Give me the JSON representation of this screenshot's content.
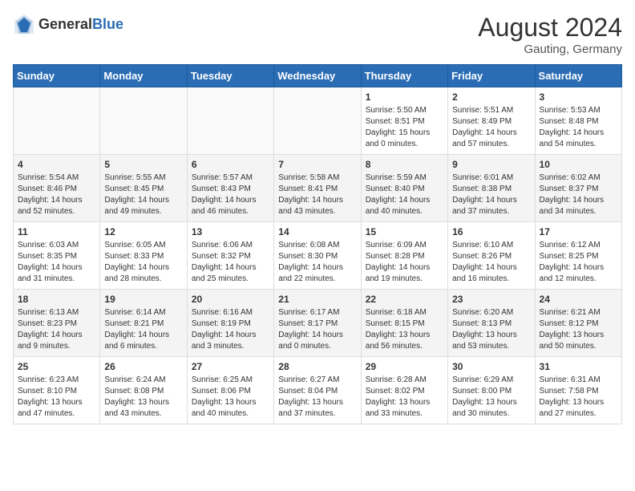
{
  "header": {
    "logo_general": "General",
    "logo_blue": "Blue",
    "month_year": "August 2024",
    "location": "Gauting, Germany"
  },
  "weekdays": [
    "Sunday",
    "Monday",
    "Tuesday",
    "Wednesday",
    "Thursday",
    "Friday",
    "Saturday"
  ],
  "weeks": [
    [
      {
        "day": "",
        "info": ""
      },
      {
        "day": "",
        "info": ""
      },
      {
        "day": "",
        "info": ""
      },
      {
        "day": "",
        "info": ""
      },
      {
        "day": "1",
        "info": "Sunrise: 5:50 AM\nSunset: 8:51 PM\nDaylight: 15 hours\nand 0 minutes."
      },
      {
        "day": "2",
        "info": "Sunrise: 5:51 AM\nSunset: 8:49 PM\nDaylight: 14 hours\nand 57 minutes."
      },
      {
        "day": "3",
        "info": "Sunrise: 5:53 AM\nSunset: 8:48 PM\nDaylight: 14 hours\nand 54 minutes."
      }
    ],
    [
      {
        "day": "4",
        "info": "Sunrise: 5:54 AM\nSunset: 8:46 PM\nDaylight: 14 hours\nand 52 minutes."
      },
      {
        "day": "5",
        "info": "Sunrise: 5:55 AM\nSunset: 8:45 PM\nDaylight: 14 hours\nand 49 minutes."
      },
      {
        "day": "6",
        "info": "Sunrise: 5:57 AM\nSunset: 8:43 PM\nDaylight: 14 hours\nand 46 minutes."
      },
      {
        "day": "7",
        "info": "Sunrise: 5:58 AM\nSunset: 8:41 PM\nDaylight: 14 hours\nand 43 minutes."
      },
      {
        "day": "8",
        "info": "Sunrise: 5:59 AM\nSunset: 8:40 PM\nDaylight: 14 hours\nand 40 minutes."
      },
      {
        "day": "9",
        "info": "Sunrise: 6:01 AM\nSunset: 8:38 PM\nDaylight: 14 hours\nand 37 minutes."
      },
      {
        "day": "10",
        "info": "Sunrise: 6:02 AM\nSunset: 8:37 PM\nDaylight: 14 hours\nand 34 minutes."
      }
    ],
    [
      {
        "day": "11",
        "info": "Sunrise: 6:03 AM\nSunset: 8:35 PM\nDaylight: 14 hours\nand 31 minutes."
      },
      {
        "day": "12",
        "info": "Sunrise: 6:05 AM\nSunset: 8:33 PM\nDaylight: 14 hours\nand 28 minutes."
      },
      {
        "day": "13",
        "info": "Sunrise: 6:06 AM\nSunset: 8:32 PM\nDaylight: 14 hours\nand 25 minutes."
      },
      {
        "day": "14",
        "info": "Sunrise: 6:08 AM\nSunset: 8:30 PM\nDaylight: 14 hours\nand 22 minutes."
      },
      {
        "day": "15",
        "info": "Sunrise: 6:09 AM\nSunset: 8:28 PM\nDaylight: 14 hours\nand 19 minutes."
      },
      {
        "day": "16",
        "info": "Sunrise: 6:10 AM\nSunset: 8:26 PM\nDaylight: 14 hours\nand 16 minutes."
      },
      {
        "day": "17",
        "info": "Sunrise: 6:12 AM\nSunset: 8:25 PM\nDaylight: 14 hours\nand 12 minutes."
      }
    ],
    [
      {
        "day": "18",
        "info": "Sunrise: 6:13 AM\nSunset: 8:23 PM\nDaylight: 14 hours\nand 9 minutes."
      },
      {
        "day": "19",
        "info": "Sunrise: 6:14 AM\nSunset: 8:21 PM\nDaylight: 14 hours\nand 6 minutes."
      },
      {
        "day": "20",
        "info": "Sunrise: 6:16 AM\nSunset: 8:19 PM\nDaylight: 14 hours\nand 3 minutes."
      },
      {
        "day": "21",
        "info": "Sunrise: 6:17 AM\nSunset: 8:17 PM\nDaylight: 14 hours\nand 0 minutes."
      },
      {
        "day": "22",
        "info": "Sunrise: 6:18 AM\nSunset: 8:15 PM\nDaylight: 13 hours\nand 56 minutes."
      },
      {
        "day": "23",
        "info": "Sunrise: 6:20 AM\nSunset: 8:13 PM\nDaylight: 13 hours\nand 53 minutes."
      },
      {
        "day": "24",
        "info": "Sunrise: 6:21 AM\nSunset: 8:12 PM\nDaylight: 13 hours\nand 50 minutes."
      }
    ],
    [
      {
        "day": "25",
        "info": "Sunrise: 6:23 AM\nSunset: 8:10 PM\nDaylight: 13 hours\nand 47 minutes."
      },
      {
        "day": "26",
        "info": "Sunrise: 6:24 AM\nSunset: 8:08 PM\nDaylight: 13 hours\nand 43 minutes."
      },
      {
        "day": "27",
        "info": "Sunrise: 6:25 AM\nSunset: 8:06 PM\nDaylight: 13 hours\nand 40 minutes."
      },
      {
        "day": "28",
        "info": "Sunrise: 6:27 AM\nSunset: 8:04 PM\nDaylight: 13 hours\nand 37 minutes."
      },
      {
        "day": "29",
        "info": "Sunrise: 6:28 AM\nSunset: 8:02 PM\nDaylight: 13 hours\nand 33 minutes."
      },
      {
        "day": "30",
        "info": "Sunrise: 6:29 AM\nSunset: 8:00 PM\nDaylight: 13 hours\nand 30 minutes."
      },
      {
        "day": "31",
        "info": "Sunrise: 6:31 AM\nSunset: 7:58 PM\nDaylight: 13 hours\nand 27 minutes."
      }
    ]
  ]
}
